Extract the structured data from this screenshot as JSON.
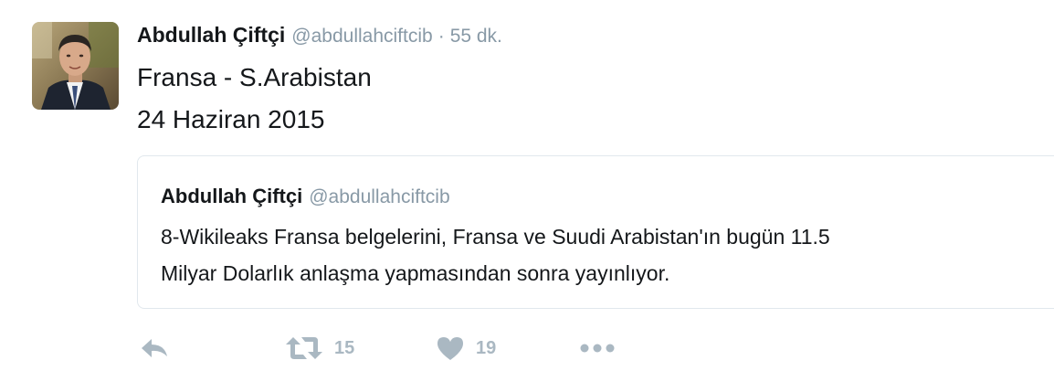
{
  "tweet": {
    "author_name": "Abdullah Çiftçi",
    "author_handle": "@abdullahciftcib",
    "separator": "·",
    "time": "55 dk.",
    "text_lines": [
      "Fransa - S.Arabistan",
      "24 Haziran 2015"
    ]
  },
  "quoted_tweet": {
    "author_name": "Abdullah Çiftçi",
    "author_handle": "@abdullahciftcib",
    "text_lines": [
      "8-Wikileaks Fransa belgelerini, Fransa ve Suudi Arabistan'ın bugün  11.5",
      "Milyar Dolarlık anlaşma yapmasından sonra yayınlıyor."
    ]
  },
  "actions": {
    "reply_icon": "reply-icon",
    "retweet_icon": "retweet-icon",
    "retweet_count": "15",
    "like_icon": "heart-icon",
    "like_count": "19",
    "more_icon": "more-dots-icon"
  },
  "colors": {
    "text": "#14171a",
    "muted": "#8899a6",
    "action_gray": "#aab8c2",
    "border": "#e1e8ed"
  }
}
